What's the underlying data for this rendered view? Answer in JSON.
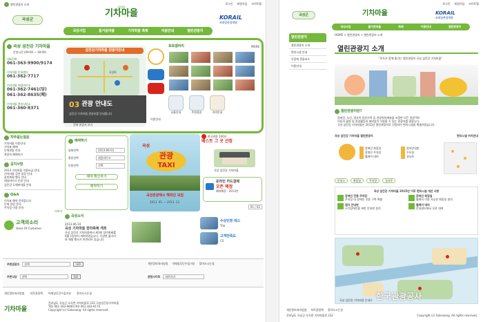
{
  "left": {
    "top_links": {
      "home_title": "열린관광지 소개",
      "links": [
        "로그인",
        "회원가입",
        "사이트맵"
      ]
    },
    "brand": {
      "county_logo": "곡성군",
      "village_title": "기차마을",
      "village_sub": "섬진강",
      "korail": "KORAIL",
      "korail_sub": "코레일관광개발"
    },
    "gnb": [
      "곡성사업",
      "즐거운마을",
      "기차마을 축제",
      "이용안내",
      "열린관광지"
    ],
    "info": {
      "title": "곡성 섬진강 기차마을",
      "hours": "운영시간 (09:00 ~ 18:00)",
      "phones": [
        {
          "label": "대표전화",
          "num": "061-363-9900/9174"
        },
        {
          "label": "기차마을 안내센터",
          "num": "061-362-7717"
        },
        {
          "label": "기차마을 레일바이크",
          "num": "061-362-7461(당)",
          "num2": "061-362-8635(폐)"
        },
        {
          "label": "기차마을 관리사업소",
          "num": "061-360-8371"
        }
      ]
    },
    "map_banner": {
      "title": "섬진강기차마을 관광지안내",
      "road": "곡성IC",
      "num": "03",
      "main": "관광 안내도",
      "sub": "섬진강 기차마을 관광지를 안내합니다",
      "tag": "전체 관광지 보기",
      "link": "이용안내"
    },
    "gallery": {
      "title": "포토갤러리",
      "more": "MORE",
      "icons": [
        {
          "label": "교통안내"
        },
        {
          "label": "주변관광"
        },
        {
          "label": "숙박안내"
        }
      ]
    },
    "side_menu": {
      "items": [
        "자주묻는질문",
        "기차마을 이용안내",
        "기차표 예매",
        "단체관람 안내",
        "관광지 예매하기"
      ]
    },
    "notice": {
      "title": "공지사항",
      "items": [
        "2013 기차마을 이용요금 안내",
        "기차마을 공연 일정 안내",
        "장미축제 행사 안내",
        "레일바이크 운영 안내",
        "섬진강 도깨비마을 안내"
      ]
    },
    "qna": {
      "title": "Q&A",
      "items": [
        "기차표 예약 문의합니다",
        "단체 관람 문의",
        "주차장 이용 문의"
      ],
      "more": "더보기"
    },
    "voice": {
      "label": "고객의소리",
      "sub": "Voice Of Customer"
    },
    "reserve": {
      "title": "예약하기",
      "date_label": "날짜선택",
      "date_value": "2013-06-01",
      "kind_label": "종류선택",
      "kind_value": "레일바이크",
      "count_label": "인원선택",
      "count_value": "선택",
      "btn1": "예약 확인하기",
      "btn2": "예약하기"
    },
    "taxi": {
      "head": "곡성",
      "main": "관광",
      "main2": "TAXI",
      "foot": "곡성관광택시 해피단 모집",
      "date": "2013. 05. ~ 2013. 12."
    },
    "best": {
      "rank": "한국관광 100선",
      "title": "베스트 그 곳 선정",
      "sub": "곡성 섬진강 기차마을"
    },
    "online": {
      "line1": "온라인 카드결제",
      "line2": "오픈 예정",
      "sub": "예약예정 : 2013년"
    },
    "page_nav": "01 / 02",
    "news": {
      "title": "곡성소식",
      "date": "2013-06-10",
      "headline": "곡성 기차마을 장미축제 개최",
      "body": [
        "곡성 섬진강 기차마을에서 제3회 장미축제를",
        "6월 1일부터 개최하였습니다. 다양한 볼거리",
        "와 체험 행사가 마련되어 있습니다."
      ]
    },
    "promo": [
      {
        "label": "수상인정 레스",
        "sub": "Trip"
      },
      {
        "label": "고객만족도",
        "sub": "CS"
      }
    ],
    "bottom": {
      "row1_label": "주변관광지",
      "row1_value": "선택",
      "row2_label": "주변식당",
      "row2_value": "선택",
      "links": [
        "개인정보처리방침",
        "이메일무단수집거부",
        "찾아오시는길"
      ],
      "family_label": "관련사이트",
      "family_value": "바로가기"
    },
    "footer": {
      "links": [
        "개인정보처리방침",
        "저작권정책",
        "이메일무단수집거부",
        "찾아오시는길"
      ],
      "address": "전라남도 곡성군 오곡면 기차마을로 232 곡성섬진강기차마을",
      "tel": "TEL 061-363-9900 FAX 061-363-9174",
      "copy": "Copyright (c) Gokseong. All rights reserved.",
      "logo": "기차마을"
    }
  },
  "right": {
    "top_links": {
      "links": [
        "로그인",
        "회원가입",
        "사이트맵"
      ]
    },
    "brand": {
      "county_logo": "곡성군",
      "village_title": "기차마을",
      "korail": "KORAIL",
      "korail_sub": "코레일관광개발"
    },
    "gnb": [
      "곡성사업",
      "즐거운마을",
      "축제",
      "이용안내",
      "열린관광지"
    ],
    "lnb": {
      "title": "열린관광지",
      "items": [
        "열린관광지 소개",
        "편의시설 안내",
        "무장애 관광코스",
        "이용안내"
      ]
    },
    "breadcrumb": "HOME > 열린관광지 > 열린관광지 소개",
    "page_title": "열린관광지 소개",
    "quote": "\"모두가 함께 즐기는 열린관광지 곡성 섬진강 기차마을\"",
    "intro": "열린관광지란?",
    "intro_body": [
      "장애인, 노인, 영유아 동반가족 등 관광취약계층을 포함한 모든 관광객이",
      "이동의 불편 및 관광활동의 제약없이 이용할 수 있는 관광지를 말합니다."
    ],
    "intro_body2": [
      "곡성 섬진강 기차마을은 2015년 열린관광지로 선정되어 편의시설을 확충하였습니다."
    ],
    "steps_title": "곡성 섬진강 기차마을 열린관광지",
    "steps_sub": "편의시설 위치안내",
    "steps": [
      "안내소",
      "화장실",
      "주차장",
      "경사로"
    ],
    "legend": [
      "장애인 화장실",
      "장애인 주차장",
      "휠체어 대여",
      "점자안내판",
      "수유실",
      "경사로"
    ],
    "fac_title": "곡성 섬진강 기차마을 2015년 이후 편의시설 개선 사항",
    "fac": [
      {
        "t": "장애인 전용 주차장",
        "d": "주차장 내 장애인 전용 구역 확충"
      },
      {
        "t": "장애인 화장실",
        "d": "휠체어 이용 가능한 화장실 설치"
      },
      {
        "t": "점자 안내판",
        "d": "시각장애인을 위한 안내판 설치"
      },
      {
        "t": "휠체어 대여",
        "d": "안내센터에서 무료 대여"
      },
      {
        "t": "경사로 설치",
        "d": "주요 시설 진입로 경사로 설치"
      },
      {
        "t": "수유실",
        "d": "영유아 동반 가족 수유실 운영"
      },
      {
        "t": "음성 안내",
        "d": "주요 시설 음성 안내 서비스"
      },
      {
        "t": "무장애 동선",
        "d": "관광지 전체 무장애 동선 확보"
      }
    ],
    "map_caption": "곡성 섬진강 기차마을 안내도",
    "footer": {
      "links": [
        "개인정보처리방침",
        "저작권정책",
        "찾아오시는길"
      ],
      "address": "전라남도 곡성군 오곡면 기차마을로 232",
      "copy": "Copyright (c) Gokseong. All rights reserved."
    },
    "watermark": "한국관광공사"
  }
}
